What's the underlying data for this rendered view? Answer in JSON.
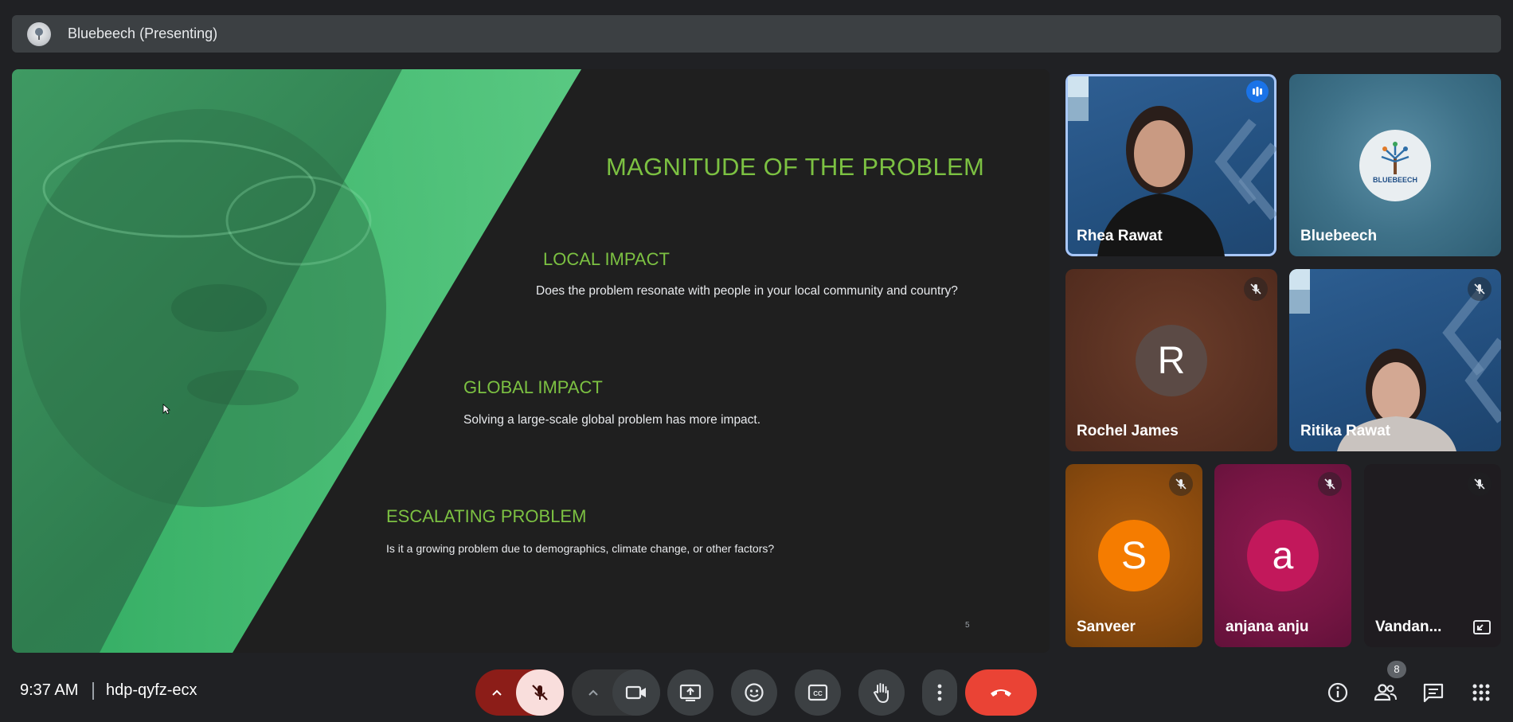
{
  "banner": {
    "title": "Bluebeech (Presenting)",
    "logo_icon": "bluebeech-logo"
  },
  "slide": {
    "title": "MAGNITUDE OF THE PROBLEM",
    "sections": [
      {
        "heading": "LOCAL IMPACT",
        "body": "Does the problem resonate with people in your local community and country?"
      },
      {
        "heading": "GLOBAL IMPACT",
        "body": "Solving a large-scale global problem has more impact."
      },
      {
        "heading": "ESCALATING PROBLEM",
        "body": "Is it a growing problem due to demographics, climate change, or other factors?"
      }
    ],
    "page_number": "5",
    "accent_color": "#7cc142"
  },
  "participants": [
    {
      "name": "Rhea Rawat",
      "type": "video",
      "speaking": true
    },
    {
      "name": "Bluebeech",
      "type": "logo",
      "logo_text": "BLUEBEECH"
    },
    {
      "name": "Rochel James",
      "type": "initial",
      "initial": "R",
      "muted": true
    },
    {
      "name": "Ritika Rawat",
      "type": "video",
      "muted": true
    },
    {
      "name": "Sanveer",
      "type": "initial",
      "initial": "S",
      "muted": true
    },
    {
      "name": "anjana anju",
      "type": "initial",
      "initial": "a",
      "muted": true
    },
    {
      "name": "Vandan...",
      "type": "blank",
      "muted": true
    }
  ],
  "footer": {
    "time": "9:37 AM",
    "meeting_code": "hdp-qyfz-ecx",
    "participant_count": "8",
    "controls": [
      "mic-options",
      "mic-off",
      "camera-options",
      "camera",
      "present",
      "emoji",
      "captions",
      "raise-hand",
      "more-options",
      "leave-call"
    ],
    "right_controls": [
      "meeting-info",
      "people",
      "chat",
      "activities"
    ]
  },
  "colors": {
    "background": "#202124",
    "control": "#3c4043",
    "leave": "#ea4335",
    "mic_off_bg": "#f9dedc",
    "mic_off_dark": "#8c1d18"
  }
}
